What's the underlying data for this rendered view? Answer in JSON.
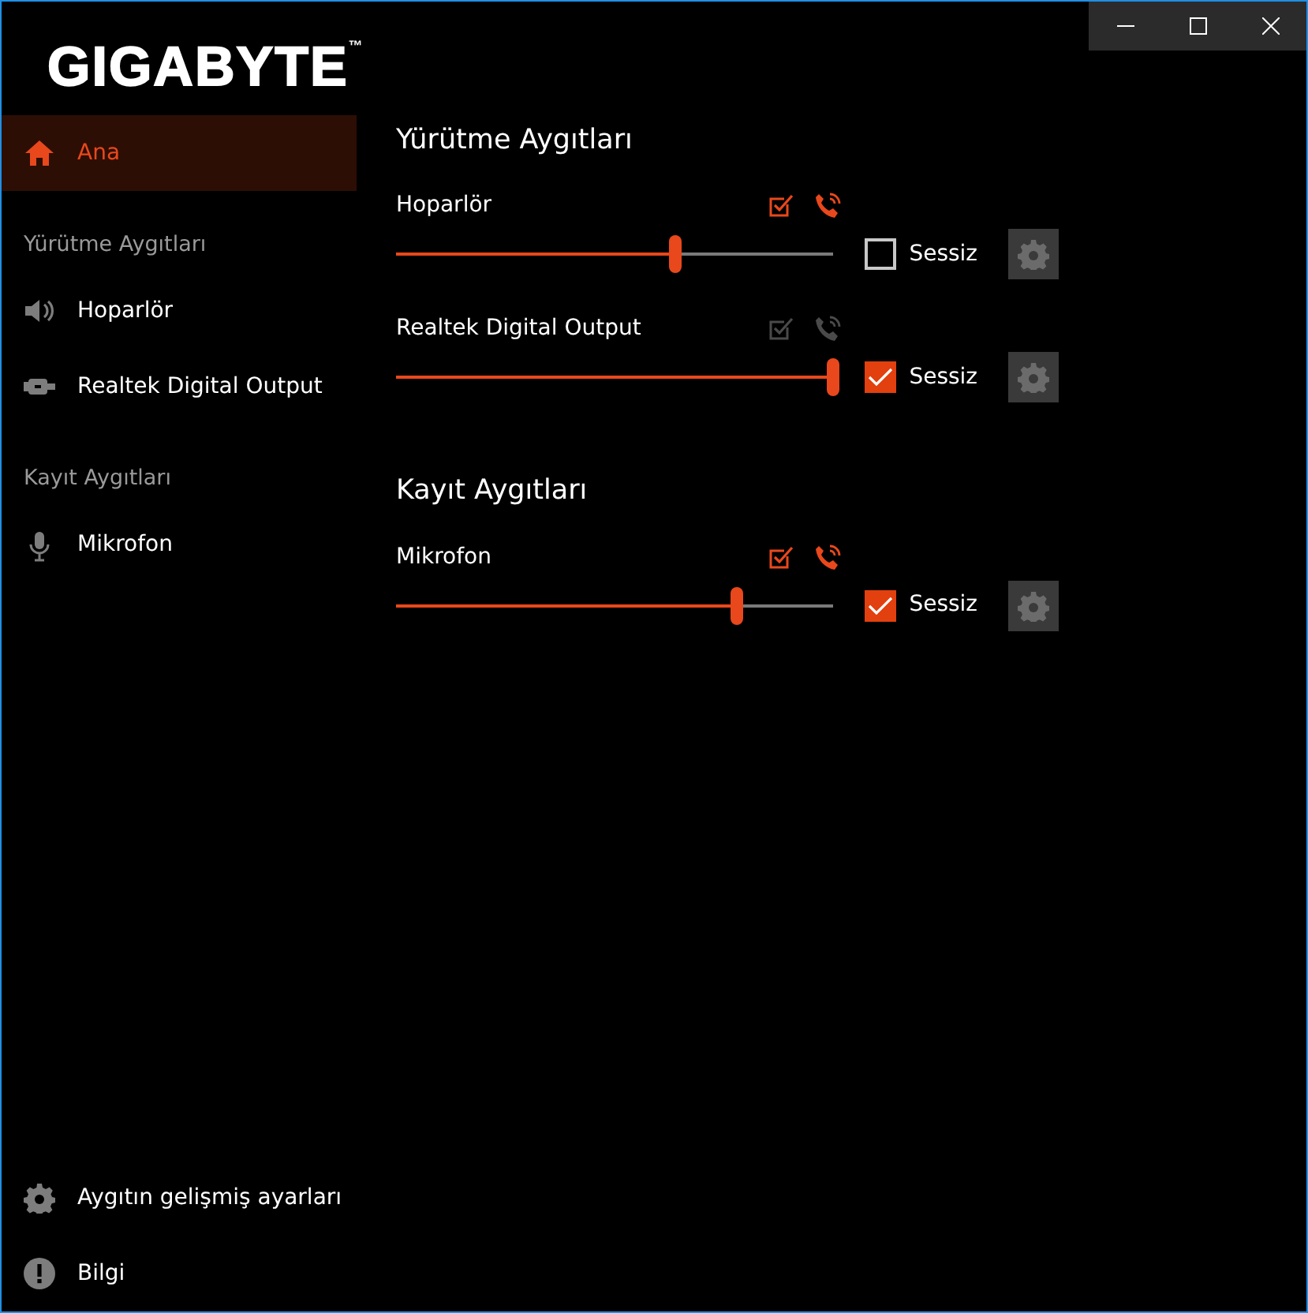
{
  "logo": "GIGABYTE$^{™}$",
  "sidebar": {
    "home": {
      "label": "Ana",
      "selected": true
    },
    "sections": [
      {
        "title": "Yürütme Aygıtları",
        "items": [
          {
            "label": "Hoparlör",
            "selected": false
          },
          {
            "label": "Realtek Digital Output",
            "selected": false
          }
        ]
      },
      {
        "title": "Kayıt Aygıtları",
        "items": [
          {
            "label": "Mikrofon",
            "selected": false
          }
        ]
      }
    ],
    "footer": [
      {
        "label": "Aygıtın gelişmiş ayarları",
        "selected": false
      },
      {
        "label": "Bilgi",
        "selected": false
      }
    ]
  },
  "groups": [
    {
      "title": "Yürütme Aygıtları",
      "devices": [
        {
          "name": "Hoparlör",
          "default_device": true,
          "default_communication": true,
          "level": 0.64,
          "muted": false,
          "mute_label": "Sessiz"
        },
        {
          "name": "Realtek Digital Output",
          "default_device": false,
          "default_communication": false,
          "level": 1.0,
          "muted": true,
          "mute_label": "Sessiz"
        }
      ]
    },
    {
      "title": "Kayıt Aygıtları",
      "devices": [
        {
          "name": "Mikrofon",
          "default_device": true,
          "default_communication": true,
          "level": 0.78,
          "muted": true,
          "mute_label": "Sessiz"
        }
      ]
    }
  ]
}
